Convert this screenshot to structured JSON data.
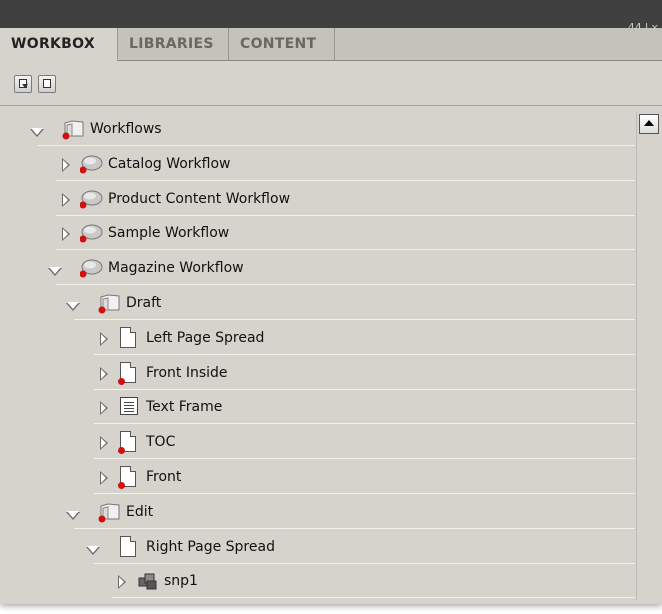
{
  "panel": {
    "title_controls": [
      "44",
      "|",
      "x"
    ],
    "tabs": [
      {
        "label": "WORKBOX",
        "active": true
      },
      {
        "label": "LIBRARIES",
        "active": false
      },
      {
        "label": "CONTENT",
        "active": false
      }
    ],
    "menu_icon": "panel-menu-icon"
  },
  "toolbar": {
    "buttons": [
      {
        "icon": "import-icon"
      },
      {
        "icon": "export-icon"
      }
    ]
  },
  "tree": {
    "items": [
      {
        "label": "Workflows",
        "level": 0,
        "expanded": true,
        "icon": "workflows-folder-icon"
      },
      {
        "label": "Catalog Workflow",
        "level": 1,
        "expanded": false,
        "icon": "workflow-icon"
      },
      {
        "label": "Product Content Workflow",
        "level": 1,
        "expanded": false,
        "icon": "workflow-icon"
      },
      {
        "label": "Sample Workflow",
        "level": 1,
        "expanded": false,
        "icon": "workflow-icon"
      },
      {
        "label": "Magazine Workflow",
        "level": 1,
        "expanded": true,
        "icon": "workflow-icon"
      },
      {
        "label": "Draft",
        "level": 2,
        "expanded": true,
        "icon": "stage-folder-icon"
      },
      {
        "label": "Left Page Spread",
        "level": 3,
        "expanded": false,
        "icon": "page-icon"
      },
      {
        "label": "Front Inside",
        "level": 3,
        "expanded": false,
        "icon": "page-icon"
      },
      {
        "label": "Text Frame",
        "level": 3,
        "expanded": false,
        "icon": "text-frame-icon"
      },
      {
        "label": "TOC",
        "level": 3,
        "expanded": false,
        "icon": "page-icon"
      },
      {
        "label": "Front",
        "level": 3,
        "expanded": false,
        "icon": "page-icon"
      },
      {
        "label": "Edit",
        "level": 2,
        "expanded": true,
        "icon": "stage-folder-icon"
      },
      {
        "label": "Right Page Spread",
        "level": 3,
        "expanded": true,
        "icon": "page-icon"
      },
      {
        "label": "snp1",
        "level": 4,
        "expanded": false,
        "icon": "snippet-icon"
      }
    ]
  },
  "colors": {
    "panel_bg": "#d6d3cc",
    "titlebar": "#404040",
    "status_dot": "#d01010"
  }
}
